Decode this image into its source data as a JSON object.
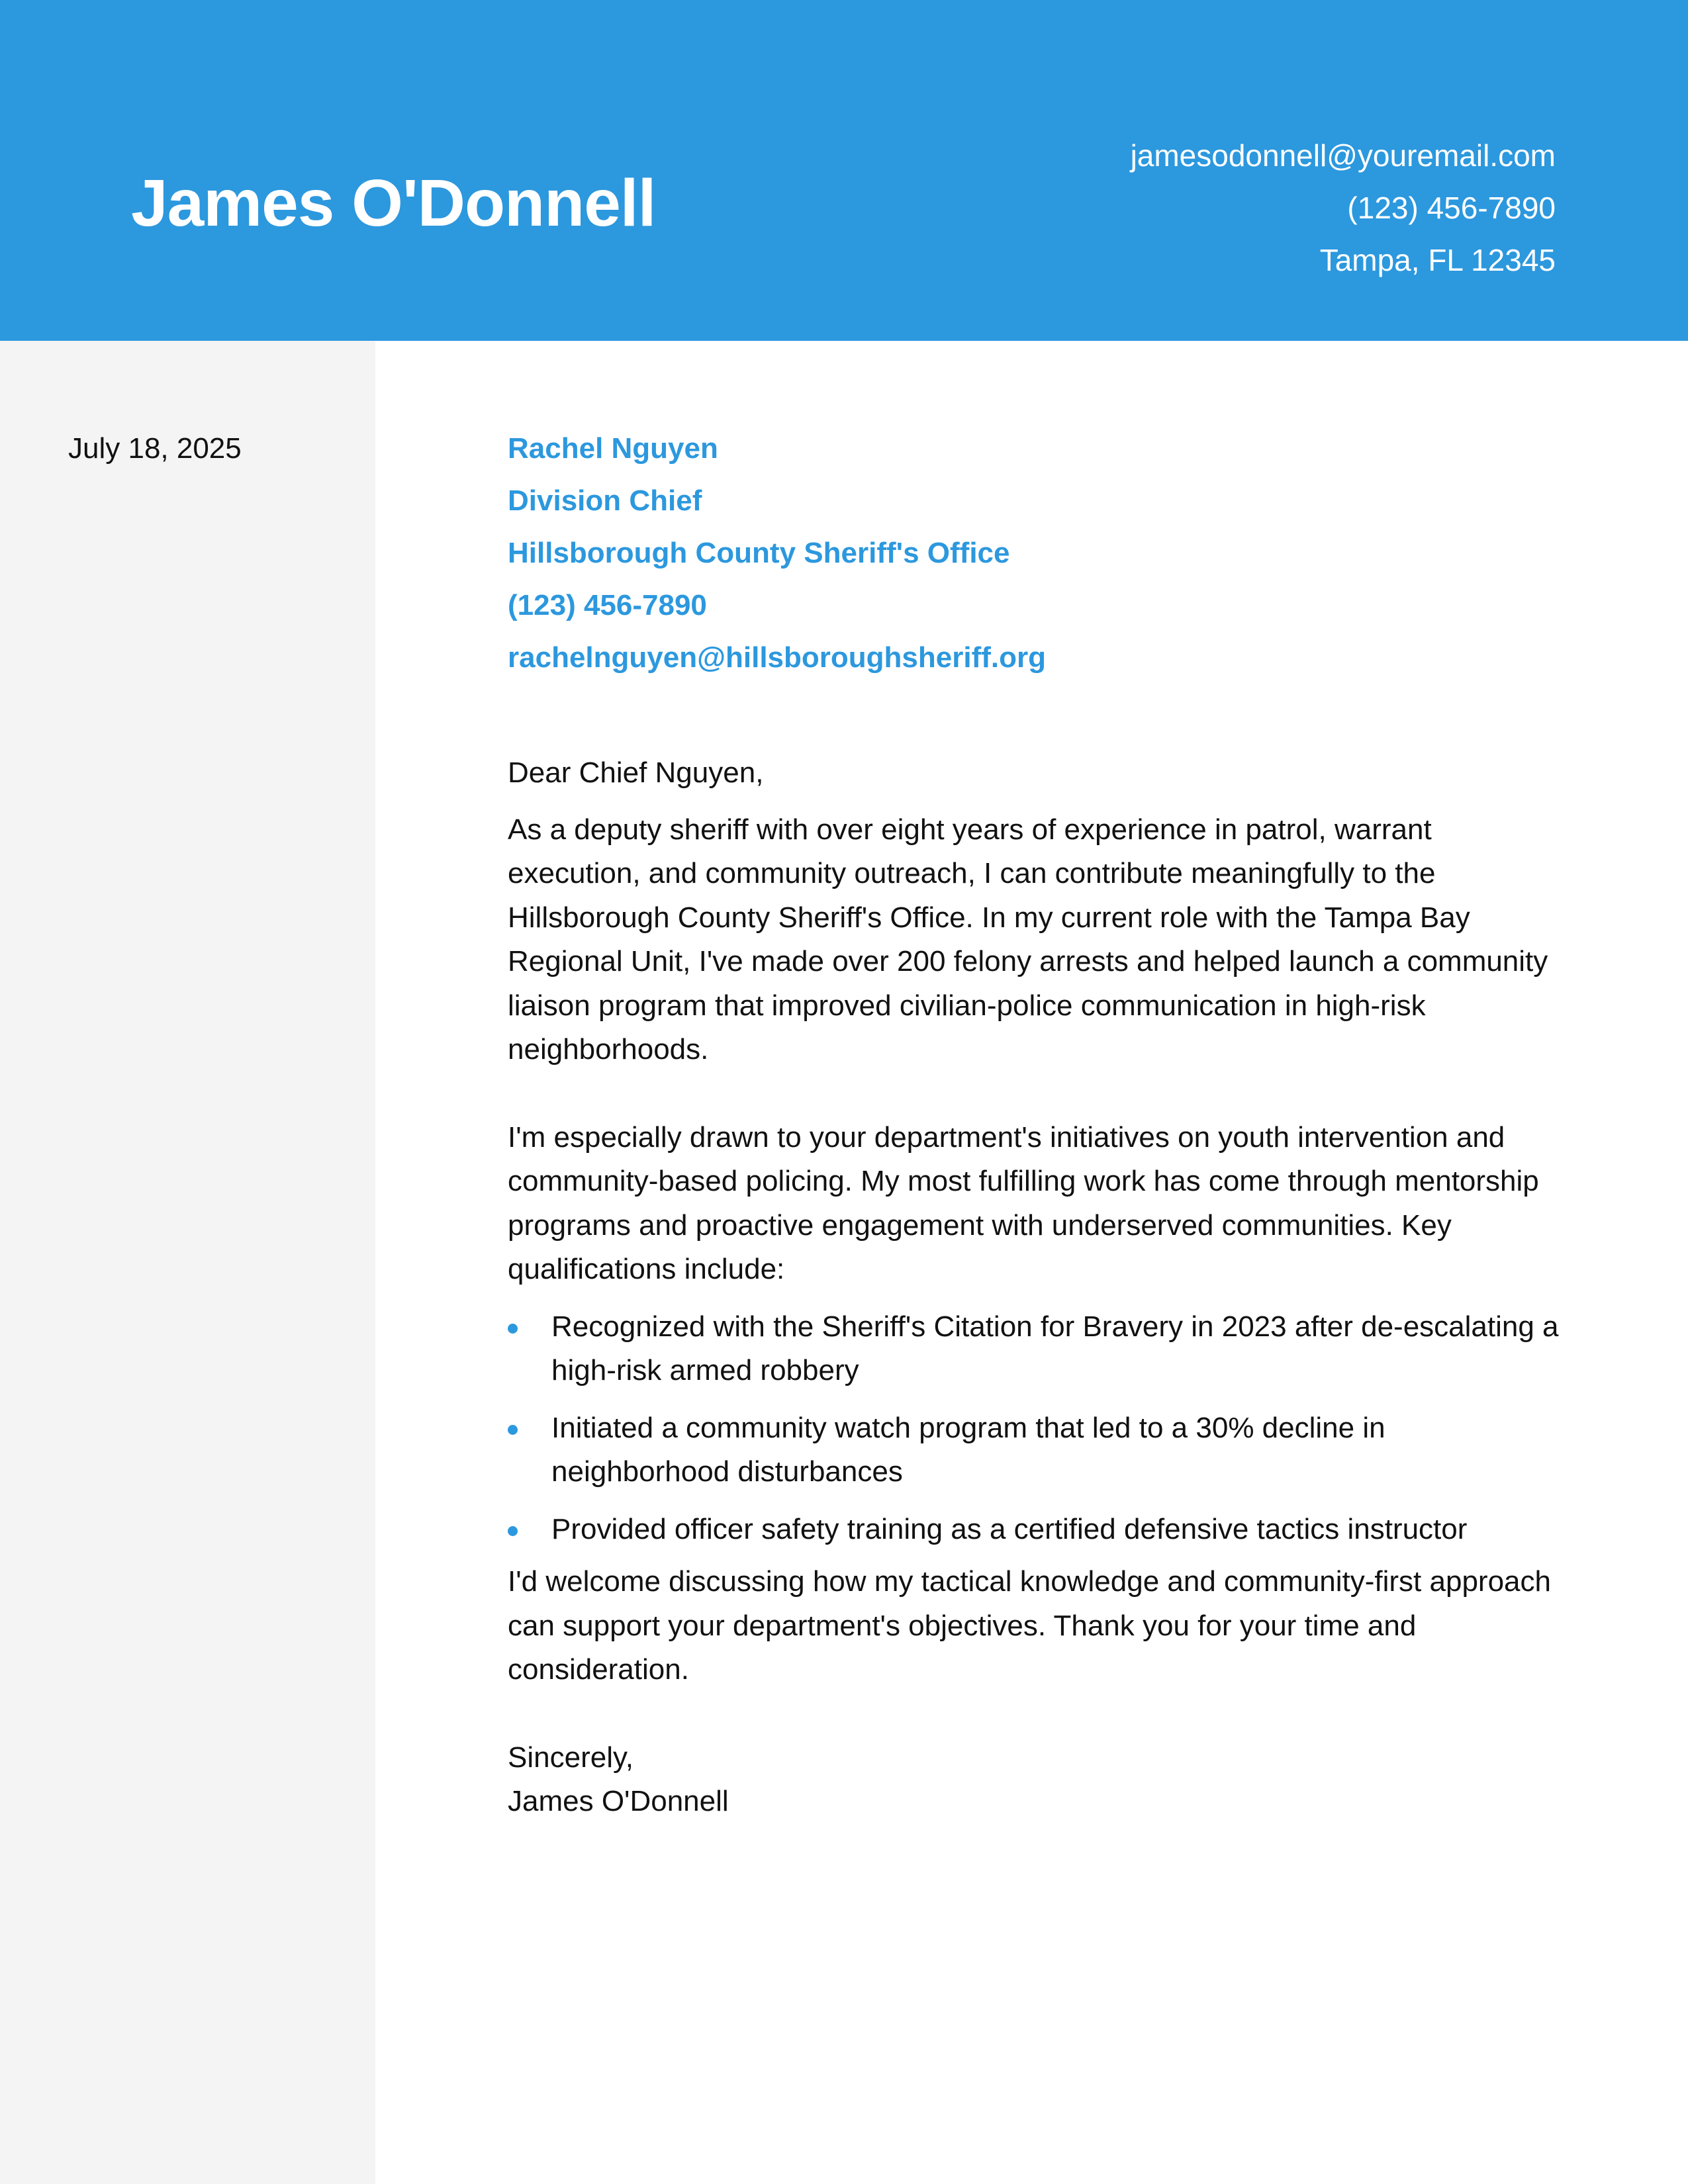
{
  "header": {
    "name": "James O'Donnell",
    "email": "jamesodonnell@youremail.com",
    "phone": "(123) 456-7890",
    "location": "Tampa, FL 12345"
  },
  "date": "July 18, 2025",
  "recipient": {
    "name": "Rachel Nguyen",
    "title": "Division Chief",
    "organization": "Hillsborough County Sheriff's Office",
    "phone": "(123) 456-7890",
    "email": "rachelnguyen@hillsboroughsheriff.org"
  },
  "letter": {
    "salutation": "Dear Chief Nguyen,",
    "paragraph1": "As a deputy sheriff with over eight years of experience in patrol, warrant execution, and community outreach, I can contribute meaningfully to the Hillsborough County Sheriff's Office. In my current role with the Tampa Bay Regional Unit, I've made over 200 felony arrests and helped launch a community liaison program that improved civilian-police communication in high-risk neighborhoods.",
    "paragraph2": "I'm especially drawn to your department's initiatives on youth intervention and community-based policing. My most fulfilling work has come through mentorship programs and proactive engagement with underserved communities. Key qualifications include:",
    "qualifications": [
      "Recognized with the Sheriff's Citation for Bravery in 2023 after de-escalating a high-risk armed robbery",
      "Initiated a community watch program that led to a 30% decline in neighborhood disturbances",
      "Provided officer safety training as a certified defensive tactics instructor"
    ],
    "paragraph3": "I'd welcome discussing how my tactical knowledge and community-first approach can support your department's objectives. Thank you for your time and consideration.",
    "closing": "Sincerely,",
    "signature": "James O'Donnell"
  },
  "colors": {
    "accent": "#2c98de",
    "sidebar": "#f4f4f4",
    "text": "#111111"
  }
}
